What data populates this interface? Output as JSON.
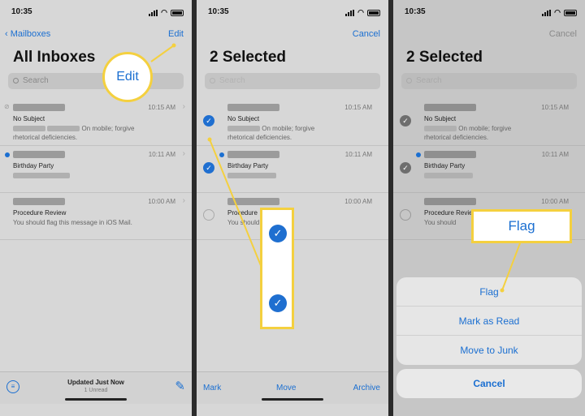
{
  "status": {
    "time": "10:35"
  },
  "panel1": {
    "back_label": "Mailboxes",
    "edit_label": "Edit",
    "title": "All Inboxes",
    "search_placeholder": "Search",
    "callout_label": "Edit",
    "emails": [
      {
        "time": "10:15 AM",
        "subject": "No Subject",
        "preview_a": "On mobile; forgive",
        "preview_b": "rhetorical deficiencies.",
        "unread": false
      },
      {
        "time": "10:11 AM",
        "subject": "Birthday Party",
        "preview_a": "",
        "preview_b": "",
        "unread": true
      },
      {
        "time": "10:00 AM",
        "subject": "Procedure Review",
        "preview_a": "You should flag this message in iOS Mail.",
        "preview_b": "",
        "unread": false
      }
    ],
    "footer_status": "Updated Just Now",
    "footer_count": "1 Unread"
  },
  "panel2": {
    "cancel_label": "Cancel",
    "title": "2 Selected",
    "search_placeholder": "Search",
    "emails": [
      {
        "time": "10:15 AM",
        "subject": "No Subject",
        "preview_a": "On mobile; forgive",
        "preview_b": "rhetorical deficiencies.",
        "selected": true
      },
      {
        "time": "10:11 AM",
        "subject": "Birthday Party",
        "preview_a": "",
        "preview_b": "",
        "selected": true
      },
      {
        "time": "10:00 AM",
        "subject": "Procedure",
        "preview_a": "You should",
        "preview_b": "",
        "selected": false
      }
    ],
    "toolbar": {
      "mark": "Mark",
      "move": "Move",
      "archive": "Archive"
    }
  },
  "panel3": {
    "cancel_label": "Cancel",
    "title": "2 Selected",
    "search_placeholder": "Search",
    "emails": [
      {
        "time": "10:15 AM",
        "subject": "No Subject",
        "preview_a": "On mobile; forgive",
        "preview_b": "rhetorical deficiencies."
      },
      {
        "time": "10:11 AM",
        "subject": "Birthday Party",
        "preview_a": "",
        "preview_b": ""
      },
      {
        "time": "10:00 AM",
        "subject": "Procedure Review",
        "preview_a": "You should",
        "preview_b": ""
      }
    ],
    "sheet": {
      "flag": "Flag",
      "mark_read": "Mark as Read",
      "move_junk": "Move to Junk",
      "cancel": "Cancel"
    },
    "callout_label": "Flag"
  },
  "colors": {
    "accent": "#1b6fd1",
    "callout_border": "#f4d03f"
  }
}
